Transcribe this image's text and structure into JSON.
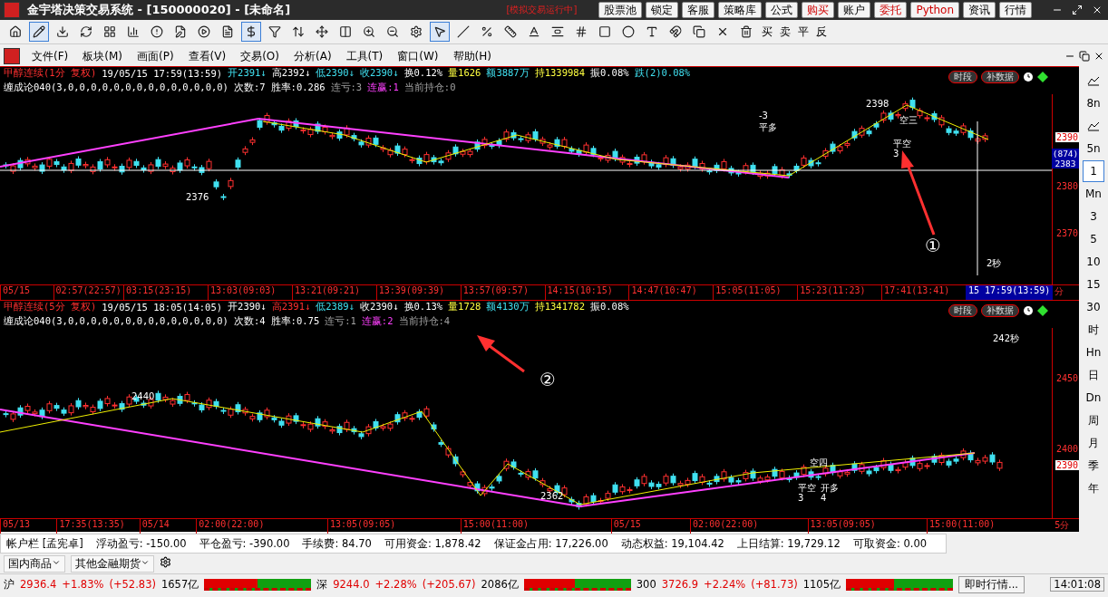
{
  "window": {
    "title": "金宇塔决策交易系统 - [150000020] - [未命名]",
    "status_note": "[模拟交易运行中]",
    "buttons": [
      {
        "label": "股票池",
        "accent": false
      },
      {
        "label": "锁定",
        "accent": false
      },
      {
        "label": "客服",
        "accent": false
      },
      {
        "label": "策略库",
        "accent": false
      },
      {
        "label": "公式",
        "accent": false
      },
      {
        "label": "购买",
        "accent": true
      },
      {
        "label": "账户",
        "accent": false
      },
      {
        "label": "委托",
        "accent": true
      },
      {
        "label": "Python",
        "accent": true
      },
      {
        "label": "资讯",
        "accent": false
      },
      {
        "label": "行情",
        "accent": false
      }
    ]
  },
  "toolbar": {
    "tools": [
      {
        "selected": false
      },
      {
        "selected": true
      },
      {
        "selected": false
      },
      {
        "selected": false
      },
      {
        "selected": false
      },
      {
        "selected": false
      },
      {
        "selected": false
      },
      {
        "selected": false
      },
      {
        "selected": false
      },
      {
        "selected": false
      },
      {
        "selected": true
      },
      {
        "selected": false
      },
      {
        "selected": false
      },
      {
        "selected": false
      },
      {
        "selected": false
      },
      {
        "selected": false
      },
      {
        "selected": false
      },
      {
        "selected": false
      },
      {
        "selected": true
      },
      {
        "selected": false
      },
      {
        "selected": false
      },
      {
        "selected": false
      },
      {
        "selected": false
      },
      {
        "selected": false
      },
      {
        "selected": false
      },
      {
        "selected": false
      },
      {
        "selected": false
      },
      {
        "selected": false
      },
      {
        "selected": false
      },
      {
        "selected": false
      },
      {
        "selected": false
      },
      {
        "selected": false
      }
    ],
    "trade_buttons": [
      "买",
      "卖",
      "平",
      "反"
    ]
  },
  "menu": [
    "文件(F)",
    "板块(M)",
    "画面(P)",
    "查看(V)",
    "交易(O)",
    "分析(A)",
    "工具(T)",
    "窗口(W)",
    "帮助(H)"
  ],
  "panels": [
    {
      "symbol": "甲醇连续(1分 复权)",
      "datetime": "19/05/15 17:59(13:59)",
      "quotes": [
        {
          "text": "开2391↓",
          "color": "#40e0f0"
        },
        {
          "text": "高2392↓",
          "color": "#ffffff"
        },
        {
          "text": "低2390↓",
          "color": "#40e0f0"
        },
        {
          "text": "收2390↓",
          "color": "#40e0f0"
        },
        {
          "text": "换0.12%",
          "color": "#ffffff"
        },
        {
          "text": "量1626",
          "color": "#ffff40"
        },
        {
          "text": "额3887万",
          "color": "#40e0f0"
        },
        {
          "text": "持1339984",
          "color": "#ffff40"
        },
        {
          "text": "振0.08%",
          "color": "#ffffff"
        },
        {
          "text": "跌(2)0.08%",
          "color": "#40e0f0"
        }
      ],
      "indicator": "缠成论040(3,0,0,0,0,0,0,0,0,0,0,0,0,0,0)",
      "stats": [
        {
          "text": "次数:7",
          "color": "#ffffff"
        },
        {
          "text": "胜率:0.286",
          "color": "#ffffff"
        },
        {
          "text": "连亏:3",
          "color": "#a0a0a0"
        },
        {
          "text": "连赢:1",
          "color": "#ff40ff"
        },
        {
          "text": "当前持仓:0",
          "color": "#a0a0a0"
        }
      ],
      "buttons": [
        "时段",
        "补数据"
      ],
      "price_labels": [
        "2380",
        "2370"
      ],
      "current_price": "2390",
      "cursor_volume": "(874)",
      "cursor_price": "2383",
      "annotations": [
        "2376",
        "-3",
        "平多",
        "2398",
        "空三",
        "平空",
        "3",
        "①",
        "2秒"
      ],
      "time_labels": [
        "05/15",
        "02:57(22:57)",
        "03:15(23:15)",
        "13:03(09:03)",
        "13:21(09:21)",
        "13:39(09:39)",
        "13:57(09:57)",
        "14:15(10:15)",
        "14:47(10:47)",
        "15:05(11:05)",
        "15:23(11:23)",
        "17:41(13:41)"
      ],
      "time_cursor": "15 17:59(13:59)",
      "period": "分"
    },
    {
      "symbol": "甲醇连续(5分 复权)",
      "datetime": "19/05/15 18:05(14:05)",
      "quotes": [
        {
          "text": "开2390↓",
          "color": "#ffffff"
        },
        {
          "text": "高2391↓",
          "color": "#ff3030"
        },
        {
          "text": "低2389↓",
          "color": "#40e0f0"
        },
        {
          "text": "收2390↓",
          "color": "#ffffff"
        },
        {
          "text": "换0.13%",
          "color": "#ffffff"
        },
        {
          "text": "量1728",
          "color": "#ffff40"
        },
        {
          "text": "额4130万",
          "color": "#40e0f0"
        },
        {
          "text": "持1341782",
          "color": "#ffff40"
        },
        {
          "text": "振0.08%",
          "color": "#ffffff"
        }
      ],
      "indicator": "缠成论040(3,0,0,0,0,0,0,0,0,0,0,0,0,0,0)",
      "stats": [
        {
          "text": "次数:4",
          "color": "#ffffff"
        },
        {
          "text": "胜率:0.75",
          "color": "#ffffff"
        },
        {
          "text": "连亏:1",
          "color": "#a0a0a0"
        },
        {
          "text": "连赢:2",
          "color": "#ff40ff"
        },
        {
          "text": "当前持仓:4",
          "color": "#a0a0a0"
        }
      ],
      "buttons": [
        "时段",
        "补数据"
      ],
      "price_labels": [
        "2450",
        "2400"
      ],
      "current_price": "2390",
      "annotations": [
        "2440",
        "2362",
        "空四",
        "平空",
        "3",
        "开多",
        "4",
        "242秒",
        "②"
      ],
      "time_labels": [
        "05/13",
        "17:35(13:35)",
        "05/14",
        "02:00(22:00)",
        "13:05(09:05)",
        "15:00(11:00)",
        "05/15",
        "02:00(22:00)",
        "13:05(09:05)",
        "15:00(11:00)"
      ],
      "period": "5分"
    }
  ],
  "periods": [
    {
      "kind": "icon",
      "selected": false
    },
    {
      "kind": "text",
      "label": "8n",
      "selected": false
    },
    {
      "kind": "icon",
      "selected": false
    },
    {
      "kind": "text",
      "label": "5n",
      "selected": false
    },
    {
      "kind": "text",
      "label": "1",
      "selected": true
    },
    {
      "kind": "text",
      "label": "Mn",
      "selected": false
    },
    {
      "kind": "text",
      "label": "3",
      "selected": false
    },
    {
      "kind": "text",
      "label": "5",
      "selected": false
    },
    {
      "kind": "text",
      "label": "10",
      "selected": false
    },
    {
      "kind": "text",
      "label": "15",
      "selected": false
    },
    {
      "kind": "text",
      "label": "30",
      "selected": false
    },
    {
      "kind": "text",
      "label": "时",
      "selected": false
    },
    {
      "kind": "text",
      "label": "Hn",
      "selected": false
    },
    {
      "kind": "text",
      "label": "日",
      "selected": false
    },
    {
      "kind": "text",
      "label": "Dn",
      "selected": false
    },
    {
      "kind": "text",
      "label": "周",
      "selected": false
    },
    {
      "kind": "text",
      "label": "月",
      "selected": false
    },
    {
      "kind": "text",
      "label": "季",
      "selected": false
    },
    {
      "kind": "text",
      "label": "年",
      "selected": false
    }
  ],
  "account": {
    "label": "帐户栏 [孟宪卓]",
    "fields": [
      "浮动盈亏: -150.00",
      "平仓盈亏: -390.00",
      "手续费: 84.70",
      "可用资金: 1,878.42",
      "保证金占用: 17,226.00",
      "动态权益: 19,104.42",
      "上日结算: 19,729.12",
      "可取资金: 0.00"
    ]
  },
  "market_tabs": [
    "国内商品",
    "其他金融期货"
  ],
  "status_bar": {
    "indices": [
      {
        "name": "沪",
        "value": "2936.4",
        "change_pct": "+1.83%",
        "change": "(+52.83)",
        "turnover": "1657亿",
        "level": 0.5
      },
      {
        "name": "深",
        "value": "9244.0",
        "change_pct": "+2.28%",
        "change": "(+205.67)",
        "turnover": "2086亿",
        "level": 0.48
      },
      {
        "name": "300",
        "value": "3726.9",
        "change_pct": "+2.24%",
        "change": "(+81.73)",
        "turnover": "1105亿",
        "level": 0.45
      }
    ],
    "quote_button": "即时行情...",
    "clock": "14:01:08"
  }
}
